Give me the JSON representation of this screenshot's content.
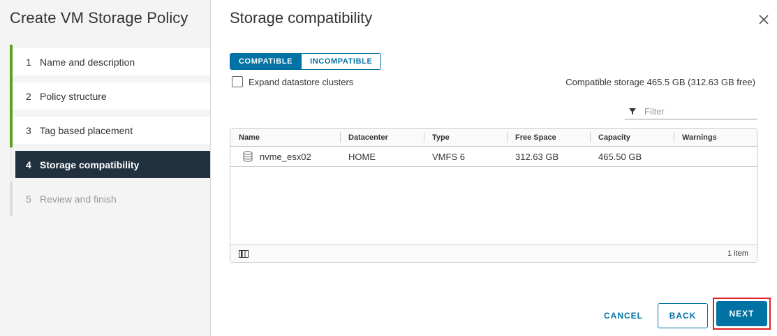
{
  "sidebar": {
    "title": "Create VM Storage Policy",
    "steps": [
      {
        "num": "1",
        "label": "Name and description"
      },
      {
        "num": "2",
        "label": "Policy structure"
      },
      {
        "num": "3",
        "label": "Tag based placement"
      },
      {
        "num": "4",
        "label": "Storage compatibility"
      },
      {
        "num": "5",
        "label": "Review and finish"
      }
    ]
  },
  "main": {
    "title": "Storage compatibility",
    "toggle": {
      "compatible": "COMPATIBLE",
      "incompatible": "INCOMPATIBLE",
      "selected": "COMPATIBLE"
    },
    "expand_label": "Expand datastore clusters",
    "compat_summary": "Compatible storage 465.5 GB (312.63 GB free)",
    "filter": {
      "placeholder": "Filter"
    },
    "grid": {
      "columns": [
        "Name",
        "Datacenter",
        "Type",
        "Free Space",
        "Capacity",
        "Warnings"
      ],
      "rows": [
        {
          "name": "nvme_esx02",
          "datacenter": "HOME",
          "type": "VMFS 6",
          "free_space": "312.63 GB",
          "capacity": "465.50 GB",
          "warnings": ""
        }
      ],
      "item_count": "1 item"
    }
  },
  "footer": {
    "cancel": "CANCEL",
    "back": "BACK",
    "next": "NEXT"
  },
  "colors": {
    "accent": "#0072a3",
    "active_step_bg": "#22313f",
    "completed_step_bar": "#5aa220",
    "highlight_frame": "#e02020"
  }
}
